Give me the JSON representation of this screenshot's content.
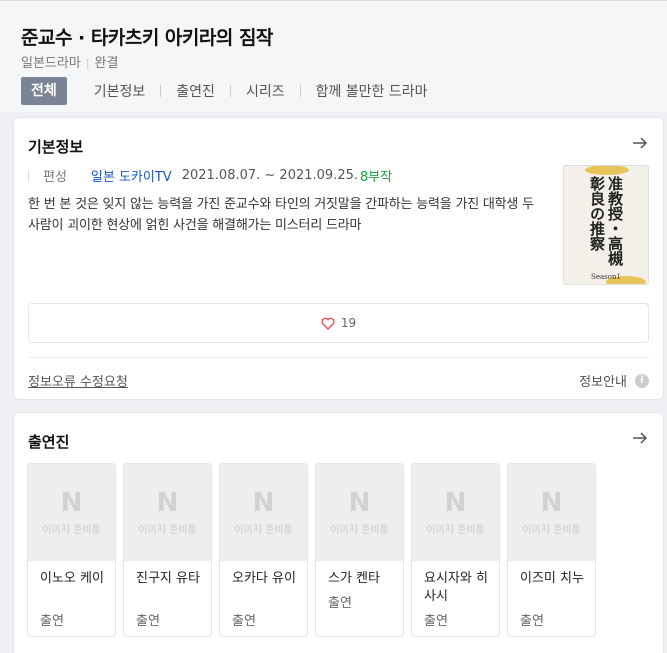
{
  "header": {
    "title": "준교수 · 타카츠키 아키라의 짐작",
    "genre": "일본드라마",
    "status": "완결",
    "tabs": [
      {
        "label": "전체",
        "active": true
      },
      {
        "label": "기본정보"
      },
      {
        "label": "출연진"
      },
      {
        "label": "시리즈"
      },
      {
        "label": "함께 볼만한 드라마"
      }
    ]
  },
  "basic_info": {
    "section_title": "기본정보",
    "arrow_icon": "arrow-right-icon",
    "schedule_label": "편성",
    "network": "일본 도카이TV",
    "dates": "2021.08.07. ~ 2021.09.25.",
    "episodes": "8부작",
    "synopsis": "한 번 본 것은 잊지 않는 능력을 가진 준교수와 타인의 거짓말을 간파하는 능력을 가진 대학생 두 사람이 괴이한 현상에 얽힌 사건을 해결해가는 미스터리 드라마",
    "poster": {
      "text": "准教授・高槻彰良の推察",
      "season": "Season1"
    },
    "likes": "19",
    "like_icon": "heart-icon",
    "report_link": "정보오류 수정요청",
    "info_guide": "정보안내",
    "info_icon": "info-icon"
  },
  "cast_section": {
    "section_title": "출연진",
    "placeholder_letter": "N",
    "placeholder_text": "이미지 준비중",
    "members": [
      {
        "name": "이노오 케이",
        "role": "출연"
      },
      {
        "name": "진구지 유타",
        "role": "출연"
      },
      {
        "name": "오카다 유이",
        "role": "출연"
      },
      {
        "name": "스가 켄타",
        "role": "출연"
      },
      {
        "name": "요시자와 히사시",
        "role": "출연"
      },
      {
        "name": "이즈미 치누",
        "role": "출연"
      }
    ]
  },
  "colors": {
    "accent_tab": "#7b8494",
    "network_link": "#1a56c9",
    "episodes": "#18a23c"
  }
}
